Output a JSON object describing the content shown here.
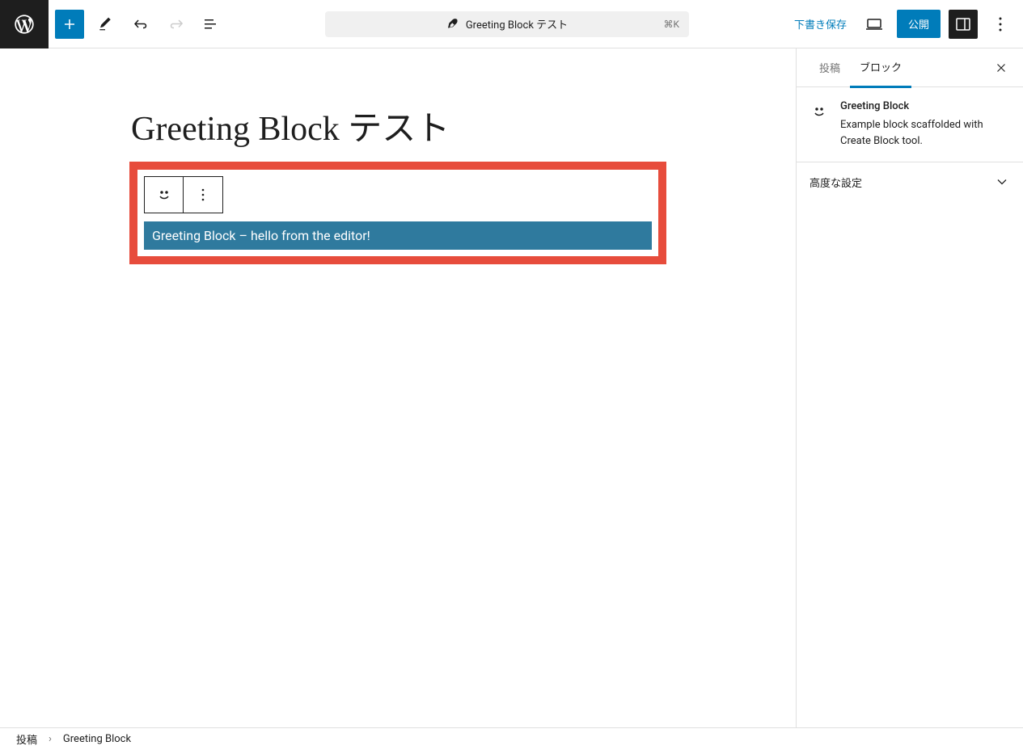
{
  "topbar": {
    "doc_title": "Greeting Block テスト",
    "shortcut": "⌘K",
    "save_draft": "下書き保存",
    "publish": "公開"
  },
  "editor": {
    "title": "Greeting Block テスト",
    "greeting_text": "Greeting Block – hello from the editor!"
  },
  "sidebar": {
    "tab_post": "投稿",
    "tab_block": "ブロック",
    "block_name": "Greeting Block",
    "block_desc": "Example block scaffolded with Create Block tool.",
    "advanced_label": "高度な設定"
  },
  "breadcrumb": {
    "root": "投稿",
    "current": "Greeting Block"
  }
}
